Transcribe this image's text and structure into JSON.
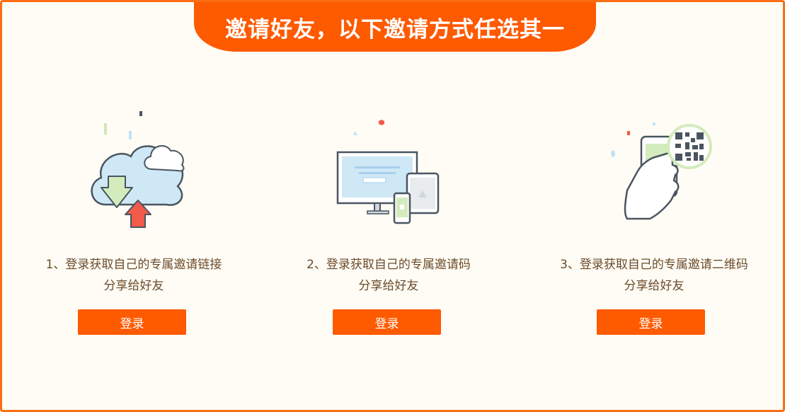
{
  "banner": {
    "title": "邀请好友，以下邀请方式任选其一"
  },
  "options": [
    {
      "line1": "1、登录获取自己的专属邀请链接",
      "line2": "分享给好友",
      "button_label": "登录",
      "icon": "cloud-upload-download-icon"
    },
    {
      "line1": "2、登录获取自己的专属邀请码",
      "line2": "分享给好友",
      "button_label": "登录",
      "icon": "multi-device-icon"
    },
    {
      "line1": "3、登录获取自己的专属邀请二维码",
      "line2": "分享给好友",
      "button_label": "登录",
      "icon": "phone-qr-code-icon"
    }
  ],
  "colors": {
    "accent": "#fe5a00",
    "border": "#fb6d12",
    "background": "#fffcf5",
    "text": "#6b4b2a"
  }
}
